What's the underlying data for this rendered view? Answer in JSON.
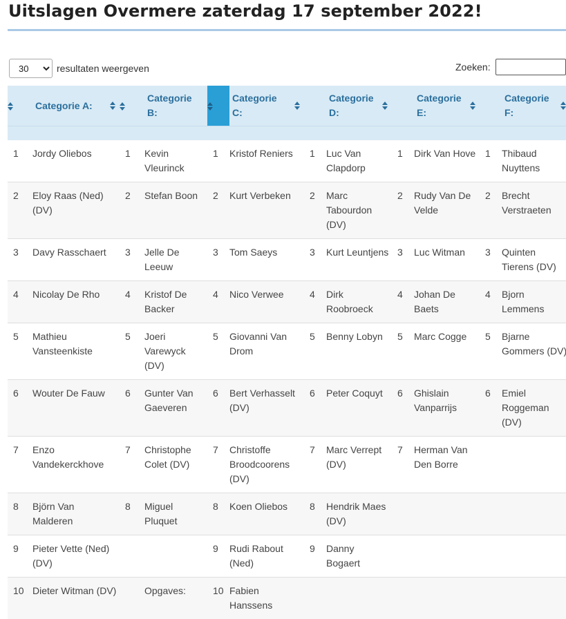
{
  "page": {
    "title": "Uitslagen Overmere zaterdag 17 september 2022!"
  },
  "length": {
    "selected": "30",
    "label": "resultaten weergeven"
  },
  "search": {
    "label": "Zoeken:",
    "value": ""
  },
  "headers": {
    "a": "Categorie A:",
    "b": [
      "Categorie",
      "B:"
    ],
    "c": [
      "Categorie",
      "C:"
    ],
    "d": [
      "Categorie",
      "D:"
    ],
    "e": [
      "Categorie",
      "E:"
    ],
    "f": [
      "Categorie",
      "F:"
    ]
  },
  "rows": [
    [
      "1",
      "Jordy Oliebos",
      "1",
      "Kevin Vleurinck",
      "1",
      "Kristof Reniers",
      "1",
      "Luc Van Clapdorp",
      "1",
      "Dirk Van Hove",
      "1",
      "Thibaud Nuyttens"
    ],
    [
      "2",
      "Eloy Raas (Ned) (DV)",
      "2",
      "Stefan Boon",
      "2",
      "Kurt Verbeken",
      "2",
      "Marc Tabourdon (DV)",
      "2",
      "Rudy Van De Velde",
      "2",
      "Brecht Verstraeten"
    ],
    [
      "3",
      "Davy Rasschaert",
      "3",
      "Jelle De Leeuw",
      "3",
      "Tom Saeys",
      "3",
      "Kurt Leuntjens",
      "3",
      "Luc Witman",
      "3",
      "Quinten Tierens (DV)"
    ],
    [
      "4",
      "Nicolay De Rho",
      "4",
      "Kristof De Backer",
      "4",
      "Nico Verwee",
      "4",
      "Dirk Roobroeck",
      "4",
      "Johan De Baets",
      "4",
      "Bjorn Lemmens"
    ],
    [
      "5",
      "Mathieu Vansteenkiste",
      "5",
      "Joeri Varewyck (DV)",
      "5",
      "Giovanni Van Drom",
      "5",
      "Benny Lobyn",
      "5",
      "Marc Cogge",
      "5",
      "Bjarne Gommers (DV)"
    ],
    [
      "6",
      "Wouter De Fauw",
      "6",
      "Gunter Van Gaeveren",
      "6",
      "Bert Verhasselt (DV)",
      "6",
      "Peter Coquyt",
      "6",
      "Ghislain Vanparrijs",
      "6",
      "Emiel Roggeman (DV)"
    ],
    [
      "7",
      "Enzo Vandekerckhove",
      "7",
      "Christophe Colet (DV)",
      "7",
      "Christoffe Broodcoorens (DV)",
      "7",
      "Marc Verrept (DV)",
      "7",
      "Herman Van Den Borre",
      "",
      ""
    ],
    [
      "8",
      "Björn Van Malderen",
      "8",
      "Miguel Pluquet",
      "8",
      "Koen Oliebos",
      "8",
      "Hendrik Maes (DV)",
      "",
      "",
      "",
      ""
    ],
    [
      "9",
      "Pieter Vette (Ned) (DV)",
      "",
      "",
      "9",
      "Rudi Rabout (Ned)",
      "9",
      "Danny Bogaert",
      "",
      "",
      "",
      ""
    ],
    [
      "10",
      "Dieter Witman (DV)",
      "",
      "Opgaves:",
      "10",
      "Fabien Hanssens",
      "",
      "",
      "",
      "",
      "",
      ""
    ]
  ]
}
